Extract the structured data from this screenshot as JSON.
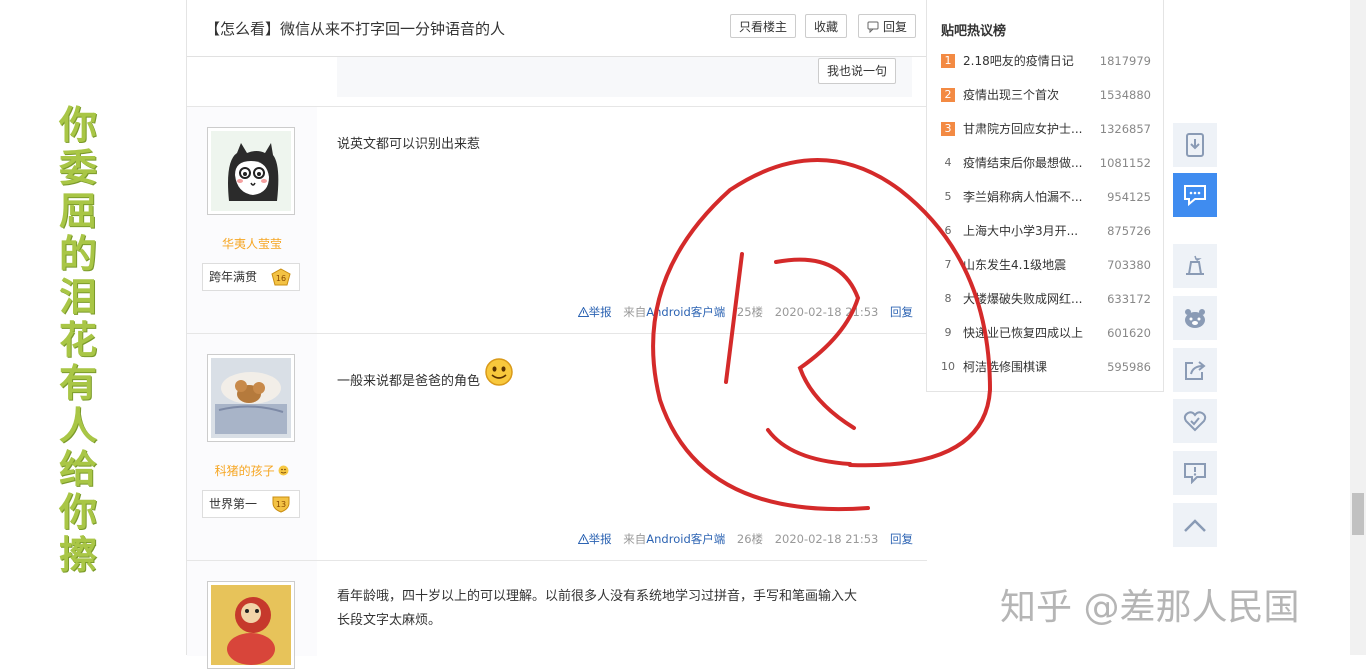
{
  "side_caption": "你委屈的泪花有人给你擦",
  "thread": {
    "title": "【怎么看】微信从来不打字回一分钟语音的人",
    "buttons": {
      "only_op": "只看楼主",
      "favorite": "收藏",
      "reply": "回复"
    },
    "speak_button": "我也说一句"
  },
  "posts": [
    {
      "username": "华夷人莹莹",
      "badge": "跨年满贯",
      "level": "16",
      "content": "说英文都可以识别出来惹",
      "report": "举报",
      "source_prefix": "来自",
      "source": "Android客户端",
      "floor": "25楼",
      "time": "2020-02-18 21:53",
      "reply": "回复"
    },
    {
      "username": "科猪的孩子",
      "badge": "世界第一",
      "level": "13",
      "content": "一般来说都是爸爸的角色",
      "report": "举报",
      "source_prefix": "来自",
      "source": "Android客户端",
      "floor": "26楼",
      "time": "2020-02-18 21:53",
      "reply": "回复"
    },
    {
      "content_line1": "看年龄哦，四十岁以上的可以理解。以前很多人没有系统地学习过拼音，手写和笔画输入大",
      "content_line2": "长段文字太麻烦。"
    }
  ],
  "hot_list": {
    "title": "贴吧热议榜",
    "items": [
      {
        "rank": "1",
        "text": "2.18吧友的疫情日记",
        "count": "1817979"
      },
      {
        "rank": "2",
        "text": "疫情出现三个首次",
        "count": "1534880"
      },
      {
        "rank": "3",
        "text": "甘肃院方回应女护士...",
        "count": "1326857"
      },
      {
        "rank": "4",
        "text": "疫情结束后你最想做...",
        "count": "1081152"
      },
      {
        "rank": "5",
        "text": "李兰娟称病人怕漏不...",
        "count": "954125"
      },
      {
        "rank": "6",
        "text": "上海大中小学3月开...",
        "count": "875726"
      },
      {
        "rank": "7",
        "text": "山东发生4.1级地震",
        "count": "703380"
      },
      {
        "rank": "8",
        "text": "大楼爆破失败成网红...",
        "count": "633172"
      },
      {
        "rank": "9",
        "text": "快递业已恢复四成以上",
        "count": "601620"
      },
      {
        "rank": "10",
        "text": "柯洁选修围棋课",
        "count": "595986"
      }
    ]
  },
  "right_toolbar": [
    "download-icon",
    "comment-icon",
    "magic-hat-icon",
    "bear-icon",
    "share-icon",
    "heart-icon",
    "report-icon",
    "back-to-top-icon"
  ],
  "watermark": "知乎 @差那人民国",
  "annotation_color": "#d42a2a"
}
